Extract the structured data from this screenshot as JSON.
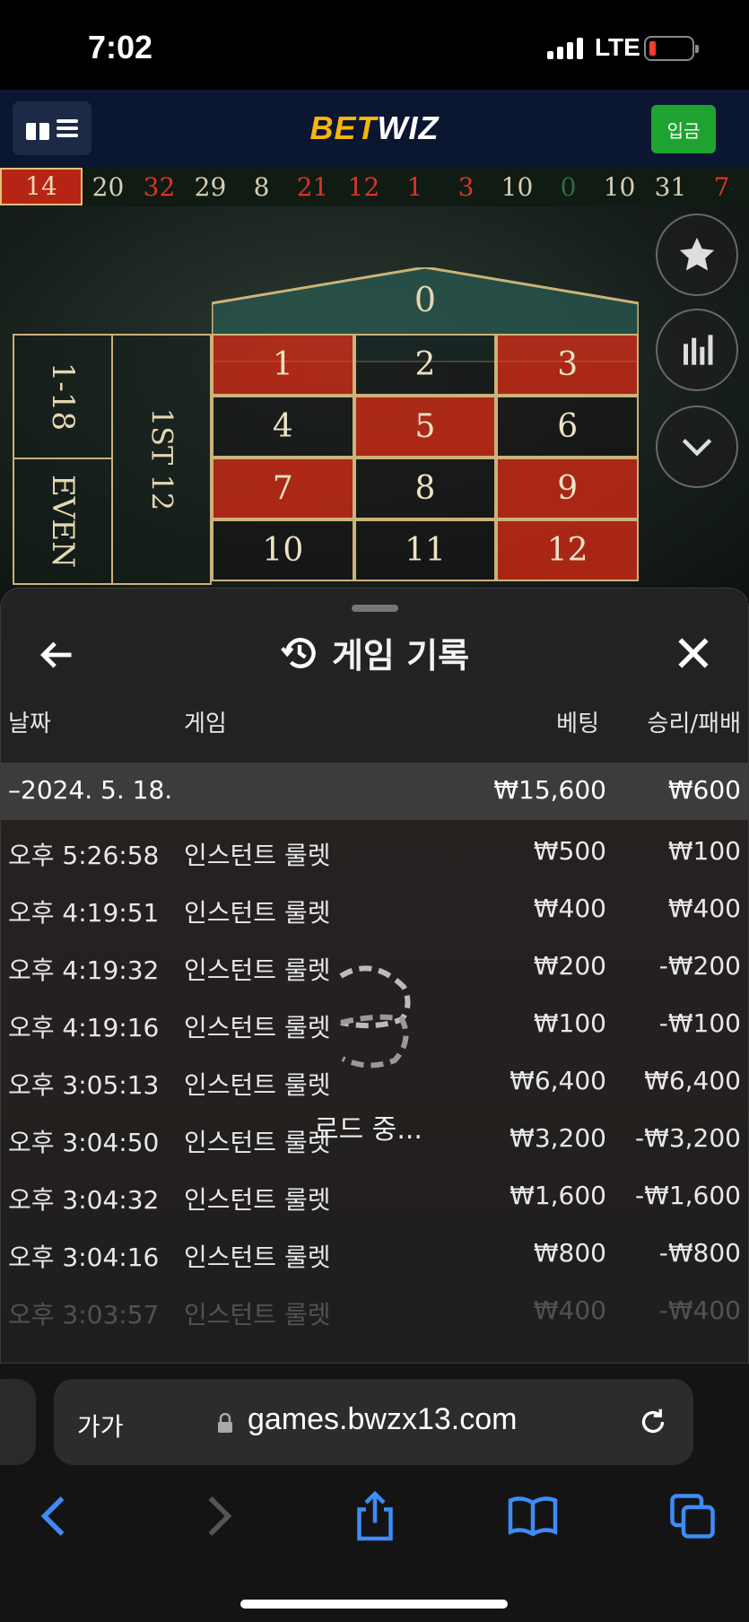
{
  "status_bar": {
    "time": "7:02",
    "network": "LTE"
  },
  "header": {
    "logo_part1": "BET",
    "logo_part2": "WIZ",
    "deposit_label": "입금",
    "accent": "#f5b50a",
    "deposit_color": "#1fa330"
  },
  "history_strip": [
    {
      "n": "14",
      "c": "r"
    },
    {
      "n": "20",
      "c": "b"
    },
    {
      "n": "32",
      "c": "r"
    },
    {
      "n": "29",
      "c": "b"
    },
    {
      "n": "8",
      "c": "b"
    },
    {
      "n": "21",
      "c": "r"
    },
    {
      "n": "12",
      "c": "r"
    },
    {
      "n": "1",
      "c": "r"
    },
    {
      "n": "3",
      "c": "r"
    },
    {
      "n": "10",
      "c": "b"
    },
    {
      "n": "0",
      "c": "g"
    },
    {
      "n": "10",
      "c": "b"
    },
    {
      "n": "31",
      "c": "b"
    },
    {
      "n": "7",
      "c": "r"
    }
  ],
  "roulette_table": {
    "zero": "0",
    "side_top": "1-18",
    "side_bottom": "EVEN",
    "dozen": "1ST 12",
    "cells": [
      {
        "n": "1",
        "c": "red"
      },
      {
        "n": "2",
        "c": "black"
      },
      {
        "n": "3",
        "c": "red"
      },
      {
        "n": "4",
        "c": "black"
      },
      {
        "n": "5",
        "c": "red"
      },
      {
        "n": "6",
        "c": "black"
      },
      {
        "n": "7",
        "c": "red"
      },
      {
        "n": "8",
        "c": "black"
      },
      {
        "n": "9",
        "c": "red"
      },
      {
        "n": "10",
        "c": "black"
      },
      {
        "n": "11",
        "c": "black"
      },
      {
        "n": "12",
        "c": "red"
      }
    ],
    "side_buttons": [
      "star-icon",
      "bar-chart-icon",
      "chevron-down-icon"
    ]
  },
  "history_sheet": {
    "title": "게임 기록",
    "columns": {
      "date": "날짜",
      "game": "게임",
      "bet": "베팅",
      "winloss": "승리/패배"
    },
    "date_group": {
      "date": "–2024. 5. 18.",
      "bet": "₩15,600",
      "winloss": "₩600"
    },
    "rows": [
      {
        "time": "오후 5:26:58",
        "game": "인스턴트 룰렛",
        "bet": "₩500",
        "winloss": "₩100"
      },
      {
        "time": "오후 4:19:51",
        "game": "인스턴트 룰렛",
        "bet": "₩400",
        "winloss": "₩400"
      },
      {
        "time": "오후 4:19:32",
        "game": "인스턴트 룰렛",
        "bet": "₩200",
        "winloss": "-₩200"
      },
      {
        "time": "오후 4:19:16",
        "game": "인스턴트 룰렛",
        "bet": "₩100",
        "winloss": "-₩100"
      },
      {
        "time": "오후 3:05:13",
        "game": "인스턴트 룰렛",
        "bet": "₩6,400",
        "winloss": "₩6,400"
      },
      {
        "time": "오후 3:04:50",
        "game": "인스턴트 룰렛",
        "bet": "₩3,200",
        "winloss": "-₩3,200"
      },
      {
        "time": "오후 3:04:32",
        "game": "인스턴트 룰렛",
        "bet": "₩1,600",
        "winloss": "-₩1,600"
      },
      {
        "time": "오후 3:04:16",
        "game": "인스턴트 룰렛",
        "bet": "₩800",
        "winloss": "-₩800"
      },
      {
        "time": "오후 3:03:57",
        "game": "인스턴트 룰렛",
        "bet": "₩400",
        "winloss": "-₩400"
      }
    ],
    "loading_text": "로드 중..."
  },
  "browser": {
    "text_size_label": "가가",
    "url": "games.bwzx13.com",
    "accent": "#3e8cf7"
  }
}
